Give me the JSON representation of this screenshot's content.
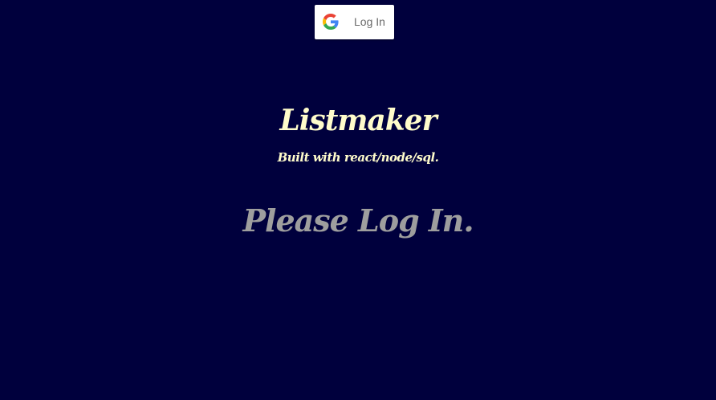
{
  "header": {
    "login_button": {
      "label": "Log In",
      "icon": "google-g-icon"
    }
  },
  "main": {
    "title": "Listmaker",
    "subtitle": "Built with react/node/sql.",
    "prompt": "Please Log In."
  },
  "colors": {
    "background": "#00003d",
    "title_text": "#fffccb",
    "prompt_text": "#9e9e9e",
    "button_background": "#ffffff",
    "button_text": "#6b6b6b",
    "google_blue": "#4285F4",
    "google_red": "#EA4335",
    "google_yellow": "#FBBC05",
    "google_green": "#34A853"
  }
}
